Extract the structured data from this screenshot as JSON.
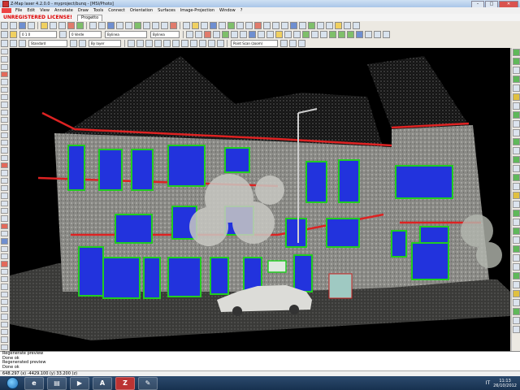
{
  "window": {
    "title": "Z-Map laser 4.2.0.0 - myproject/bunq - [MSI/Photo]",
    "buttons": {
      "minimize": "–",
      "maximize": "□",
      "close": "✕"
    }
  },
  "menu": [
    "File",
    "Edit",
    "View",
    "Annotate",
    "Draw",
    "Tools",
    "Connect",
    "Orientation",
    "Surfaces",
    "Image-Projection",
    "Window",
    "?"
  ],
  "warning": "UNREGISTERED LICENSE!",
  "project_tab": "Progetto",
  "toolbar": {
    "combo1": "0 1 0",
    "combo2": "0 Verde",
    "combo3": "Bylinea",
    "combo4": "Bylinea",
    "combo5": "Standard",
    "combo6": "By layer",
    "combo7": "Point Scan (zoom)"
  },
  "command_lines": [
    "Regenerate preview",
    "Done ok",
    "Regenerated preview",
    "Done ok"
  ],
  "status_text": "648.297 (x) -4429.100 (y) 33.200 (z)",
  "taskbar": {
    "apps": [
      {
        "name": "ie",
        "glyph": "e"
      },
      {
        "name": "explorer",
        "glyph": "▤"
      },
      {
        "name": "media",
        "glyph": "▶"
      },
      {
        "name": "autocad",
        "glyph": "A"
      },
      {
        "name": "zmap",
        "glyph": "Z"
      },
      {
        "name": "paint",
        "glyph": "✎"
      }
    ],
    "lang": "IT",
    "time": "11:13",
    "date": "26/10/2012"
  },
  "colors": {
    "window_outline": "#22cc22",
    "roof_line": "#dd2222",
    "window_fill": "#2233dd"
  }
}
